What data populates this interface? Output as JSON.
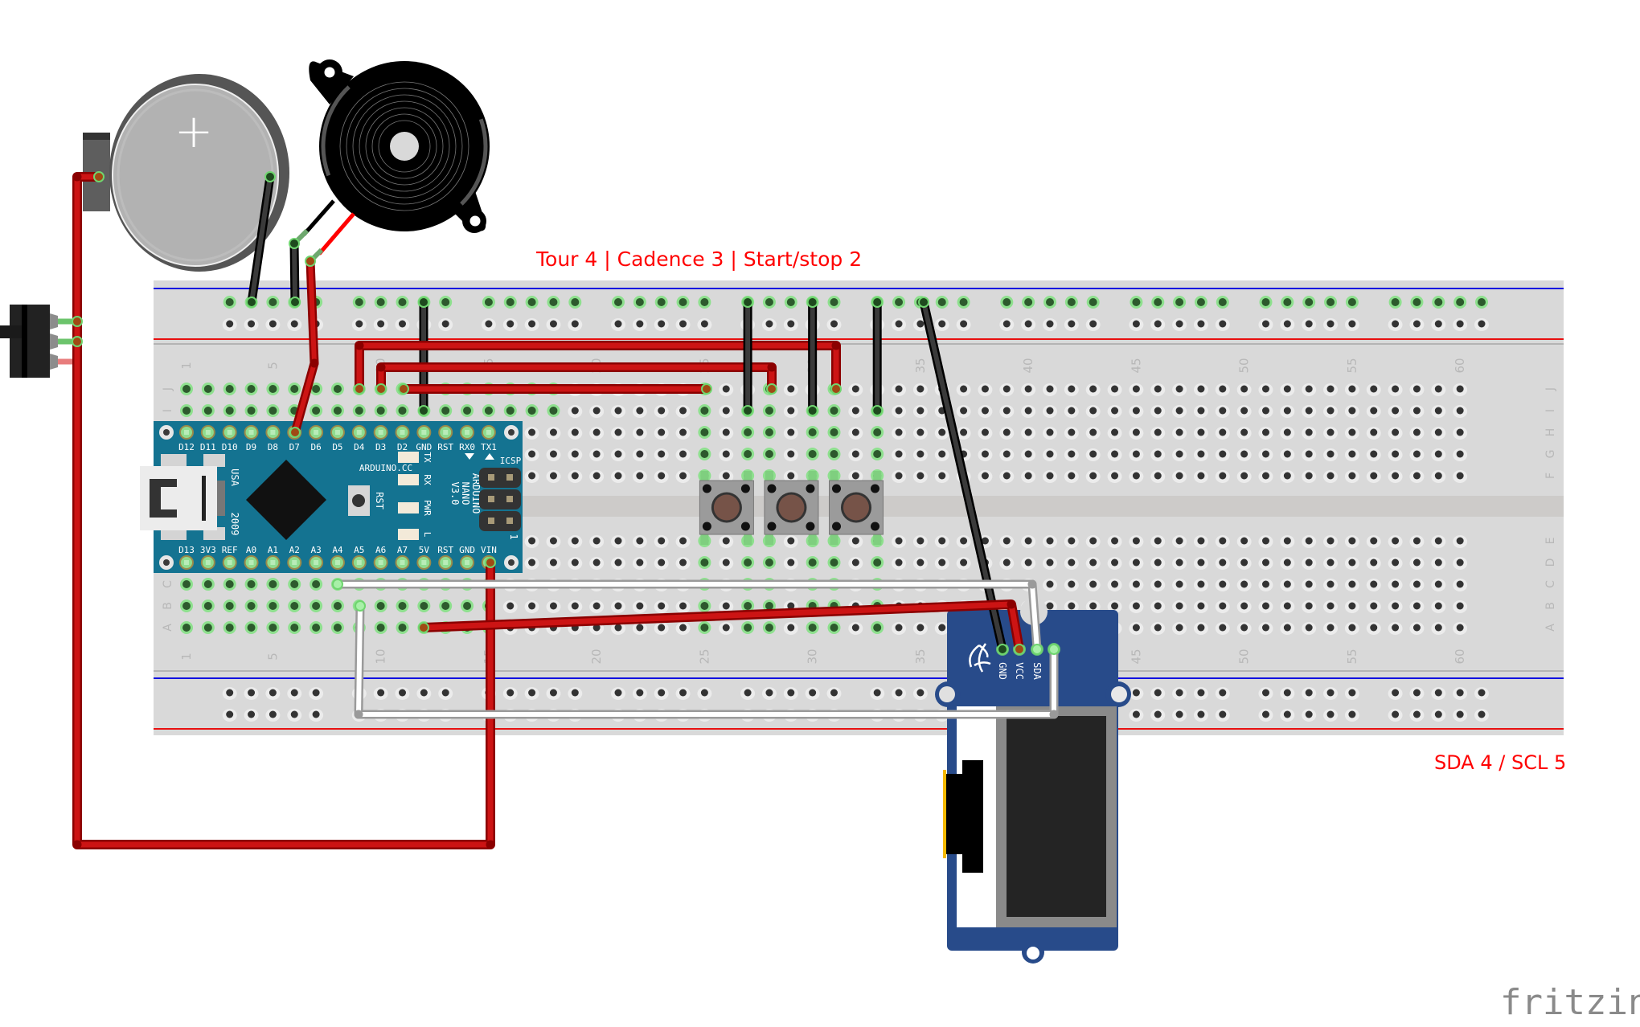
{
  "annotations": {
    "pin_note": "Tour 4 | Cadence 3 | Start/stop 2",
    "i2c_note": "SDA 4 / SCL 5"
  },
  "logo": "fritzing",
  "breadboard": {
    "columns": 60,
    "column_labels": [
      "1",
      "5",
      "10",
      "15",
      "20",
      "25",
      "30",
      "35",
      "40",
      "45",
      "50",
      "55",
      "60"
    ],
    "rows_top": [
      "J",
      "I",
      "H",
      "G",
      "F"
    ],
    "rows_bottom": [
      "E",
      "D",
      "C",
      "B",
      "A"
    ],
    "rail_groups": 10
  },
  "arduino_nano": {
    "top_pins": [
      "D12",
      "D11",
      "D10",
      "D9",
      "D8",
      "D7",
      "D6",
      "D5",
      "D4",
      "D3",
      "D2",
      "GND",
      "RST",
      "RX0",
      "TX1"
    ],
    "bottom_pins": [
      "D13",
      "3V3",
      "REF",
      "A0",
      "A1",
      "A2",
      "A3",
      "A4",
      "A5",
      "A6",
      "A7",
      "5V",
      "RST",
      "GND",
      "VIN"
    ],
    "brand": "ARDUINO.CC",
    "model_lines": [
      "ARDUINO",
      "NANO",
      "V3.0"
    ],
    "usa": "USA",
    "year": "2009",
    "reset_label": "RST",
    "led_labels": [
      "TX",
      "RX",
      "PWR",
      "L"
    ],
    "icsp_label": "ICSP",
    "header_index": "1"
  },
  "oled_module": {
    "pin_labels": [
      "GND",
      "VCC",
      "SDA",
      ""
    ]
  },
  "battery": {
    "polarity_symbol": "+"
  },
  "buttons": [
    {
      "name": "Tour",
      "pin": "D4"
    },
    {
      "name": "Cadence",
      "pin": "D3"
    },
    {
      "name": "Start/stop",
      "pin": "D2"
    }
  ],
  "wire_colors": {
    "red": "#cc1414",
    "red_dark": "#8b0000",
    "black": "#3a3a3a",
    "white": "#ffffff",
    "white_edge": "#9a9a9a"
  },
  "colors": {
    "nano_board": "#147391",
    "oled_board": "#284b8a",
    "annotation": "#ff0000",
    "breadboard": "#d9d9d9"
  }
}
